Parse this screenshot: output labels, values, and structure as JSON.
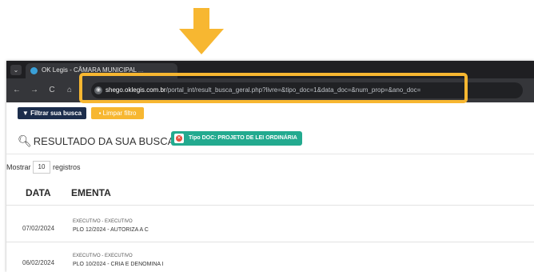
{
  "browser": {
    "tab_menu_icon": "chevron-down-icon",
    "tab_title_visible": "OK Legis - CÂMARA MUNICIPAL",
    "tab_title_fade": " ...",
    "favicon_icon": "globe-icon",
    "nav": {
      "back": "←",
      "forward": "→",
      "reload": "C",
      "home": "⌂"
    },
    "url_host": "shego.oklegis.com.br",
    "url_path": "/portal_int/result_busca_geral.php?livre=&tipo_doc=1&data_doc=&num_prop=&ano_doc="
  },
  "page": {
    "filter_button": "Filtrar sua busca",
    "clear_button": "Limpar filtro",
    "results_title": "RESULTADO DA SUA BUSCA:",
    "badge_text": "Tipo DOC: PROJETO DE LEI ORDINÁRIA",
    "show_label": "Mostrar",
    "entries_value": "10",
    "entries_label": "registros",
    "columns": [
      "DATA",
      "EMENTA"
    ],
    "rows": [
      {
        "date": "07/02/2024",
        "origin": "EXECUTIVO - EXECUTIVO",
        "summary": "PLO 12/2024 - AUTORIZA A C"
      },
      {
        "date": "06/02/2024",
        "origin": "EXECUTIVO - EXECUTIVO",
        "summary": "PLO 10/2024 - CRIA E DENOMINA I"
      }
    ]
  },
  "colors": {
    "highlight": "#f7b731",
    "filter_button": "#1c2d4c",
    "clear_button": "#f7b731",
    "badge": "#23aa8f"
  }
}
